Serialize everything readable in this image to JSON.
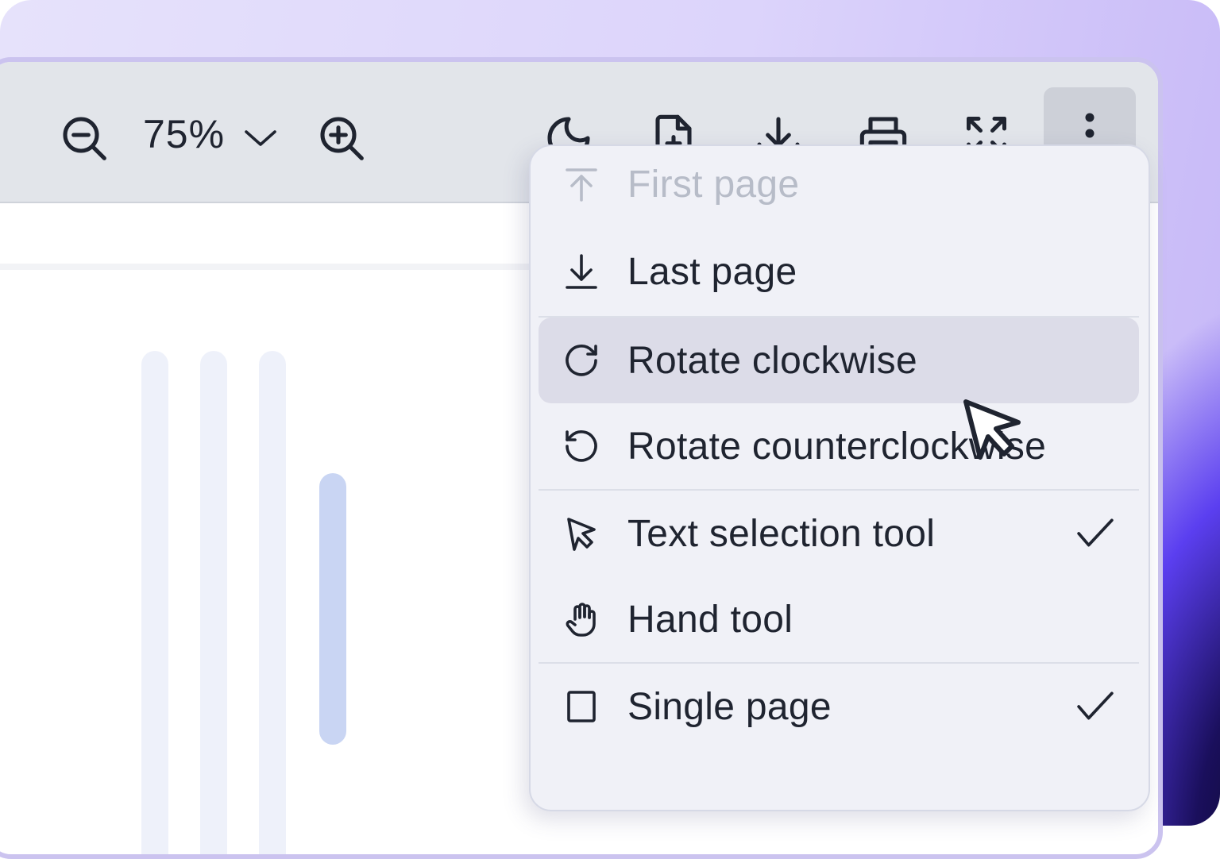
{
  "toolbar": {
    "zoom_value": "75%",
    "icons": [
      "zoom-out-icon",
      "chevron-down-icon",
      "zoom-in-icon",
      "moon-icon",
      "file-plus-icon",
      "download-icon",
      "printer-icon",
      "fullscreen-icon",
      "more-vertical-icon"
    ]
  },
  "menu": {
    "items": [
      {
        "label": "First page",
        "icon": "arrow-up-to-line-icon",
        "disabled": true
      },
      {
        "label": "Last page",
        "icon": "arrow-down-to-line-icon",
        "disabled": false
      },
      {
        "label": "Rotate clockwise",
        "icon": "rotate-cw-icon",
        "hovered": true
      },
      {
        "label": "Rotate counterclockwise",
        "icon": "rotate-ccw-icon"
      },
      {
        "label": "Text selection tool",
        "icon": "pointer-icon",
        "checked": true
      },
      {
        "label": "Hand tool",
        "icon": "hand-icon"
      },
      {
        "label": "Single page",
        "icon": "square-icon",
        "checked": true
      }
    ]
  },
  "colors": {
    "toolbar_bg": "#e2e5ea",
    "menu_bg": "#f0f1f7",
    "hover_bg": "#dcdce8",
    "text": "#1f2430",
    "disabled_text": "#b7bcc8",
    "accent_bar": "#c9d5f3"
  }
}
